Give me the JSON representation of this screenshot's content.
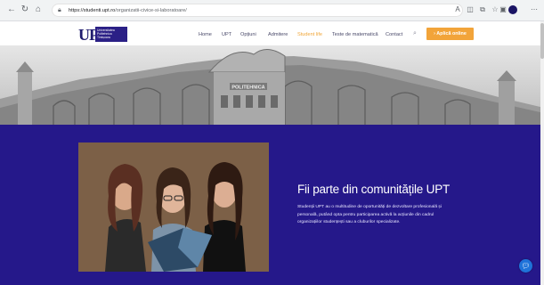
{
  "browser": {
    "url_host": "https://studenti.upt.ro",
    "url_path": "/organizatii-civice-si-laboratoare/",
    "icons": [
      "back-icon",
      "forward-icon",
      "home-icon",
      "lock-icon",
      "read-aloud-icon",
      "split-screen-icon",
      "tab-icon",
      "favorites-icon",
      "collections-icon",
      "profile-icon",
      "more-icon"
    ]
  },
  "header": {
    "logo_letters": "UP",
    "logo_lines": [
      "Universitatea",
      "Politehnica",
      "Timișoara"
    ],
    "menu": [
      "Home",
      "UPT",
      "Opțiuni",
      "Admitere",
      "Student life",
      "Teste de matematică",
      "Contact"
    ],
    "active_item": "Student life",
    "apply_label": "Aplică online",
    "accent_color": "#f2a43a"
  },
  "hero": {
    "building_sign": "POLITEHNICA"
  },
  "section": {
    "title": "Fii parte din comunitățile UPT",
    "paragraph_lines": [
      "Studenții UPT au o multitudine de oportunități de dezvoltare profesională și",
      "personală, putând opta pentru participarea activă la acțiunile din cadrul",
      "organizațiilor studențești sau a cluburilor specializate."
    ],
    "background_color": "#25188a"
  },
  "chat_widget": {
    "icon": "chat-icon"
  }
}
